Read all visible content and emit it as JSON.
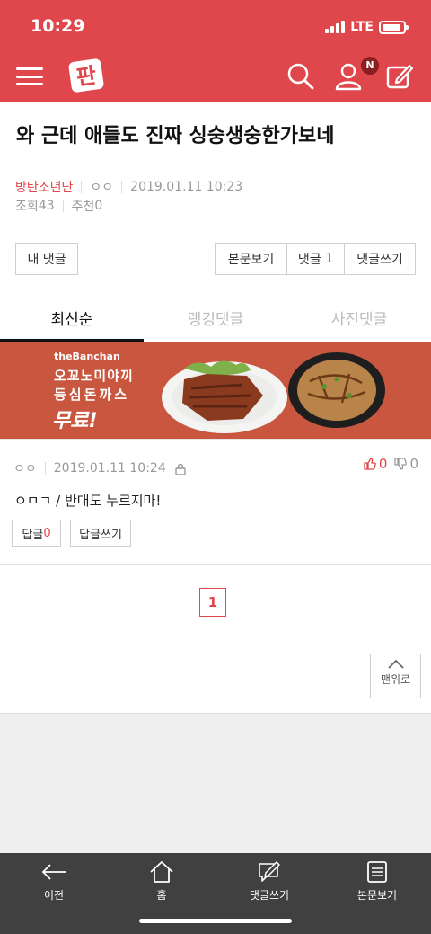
{
  "status_bar": {
    "time": "10:29",
    "network": "LTE",
    "battery_level": 0.9
  },
  "header": {
    "logo_text": "판",
    "notification_badge": "N"
  },
  "post": {
    "title": "와 근데 애들도 진짜 싱숭생숭한가보네",
    "category": "방탄소년단",
    "author": "ㅇㅇ",
    "datetime": "2019.01.11 10:23",
    "views_label": "조회",
    "views": "43",
    "recommend_label": "추천",
    "recommend": "0"
  },
  "actions": {
    "my_comments": "내 댓글",
    "view_body": "본문보기",
    "comments_label": "댓글",
    "comments_count": "1",
    "write_comment": "댓글쓰기"
  },
  "tabs": [
    {
      "label": "최신순",
      "active": true
    },
    {
      "label": "랭킹댓글",
      "active": false
    },
    {
      "label": "사진댓글",
      "active": false
    }
  ],
  "banner": {
    "brand": "theBanchan",
    "line1": "오꼬노미야끼",
    "line2": "등심돈까스",
    "line3": "무료!"
  },
  "comments": [
    {
      "author": "ㅇㅇ",
      "datetime": "2019.01.11 10:24",
      "likes": "0",
      "dislikes": "0",
      "text": "ㅇㅁㄱ / 반대도 누르지마!",
      "reply_label": "답글",
      "reply_count": "0",
      "write_reply": "답글쓰기"
    }
  ],
  "pagination": {
    "current": "1"
  },
  "to_top": "맨위로",
  "bottom_nav": [
    {
      "label": "이전",
      "icon": "arrow-left-icon"
    },
    {
      "label": "홈",
      "icon": "home-icon"
    },
    {
      "label": "댓글쓰기",
      "icon": "comment-write-icon"
    },
    {
      "label": "본문보기",
      "icon": "document-icon"
    }
  ],
  "colors": {
    "brand": "#e0474c",
    "nav_bg": "#404040"
  }
}
